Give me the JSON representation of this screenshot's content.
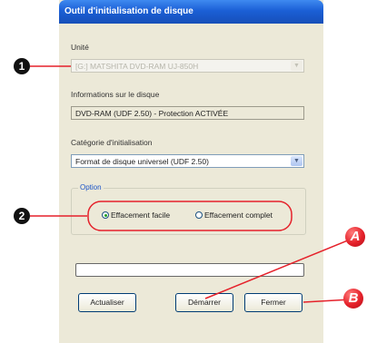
{
  "window": {
    "title": "Outil d'initialisation de disque"
  },
  "unit": {
    "label": "Unité",
    "value": "[G:] MATSHITA DVD-RAM UJ-850H"
  },
  "disc_info": {
    "label": "Informations sur le disque",
    "value": "DVD-RAM (UDF 2.50) - Protection ACTIVÉE"
  },
  "init_category": {
    "label": "Catégorie d'initialisation",
    "value": "Format de disque universel (UDF 2.50)"
  },
  "option": {
    "label": "Option",
    "quick_erase": {
      "label": "Effacement facile",
      "selected": true
    },
    "full_erase": {
      "label": "Effacement complet",
      "selected": false
    }
  },
  "buttons": {
    "refresh": "Actualiser",
    "start": "Démarrer",
    "close": "Fermer"
  },
  "callouts": {
    "one": "1",
    "two": "2",
    "a": "A",
    "b": "B"
  },
  "colors": {
    "highlight_ring": "#e5212a",
    "title_bar": "#1b5fd6"
  }
}
